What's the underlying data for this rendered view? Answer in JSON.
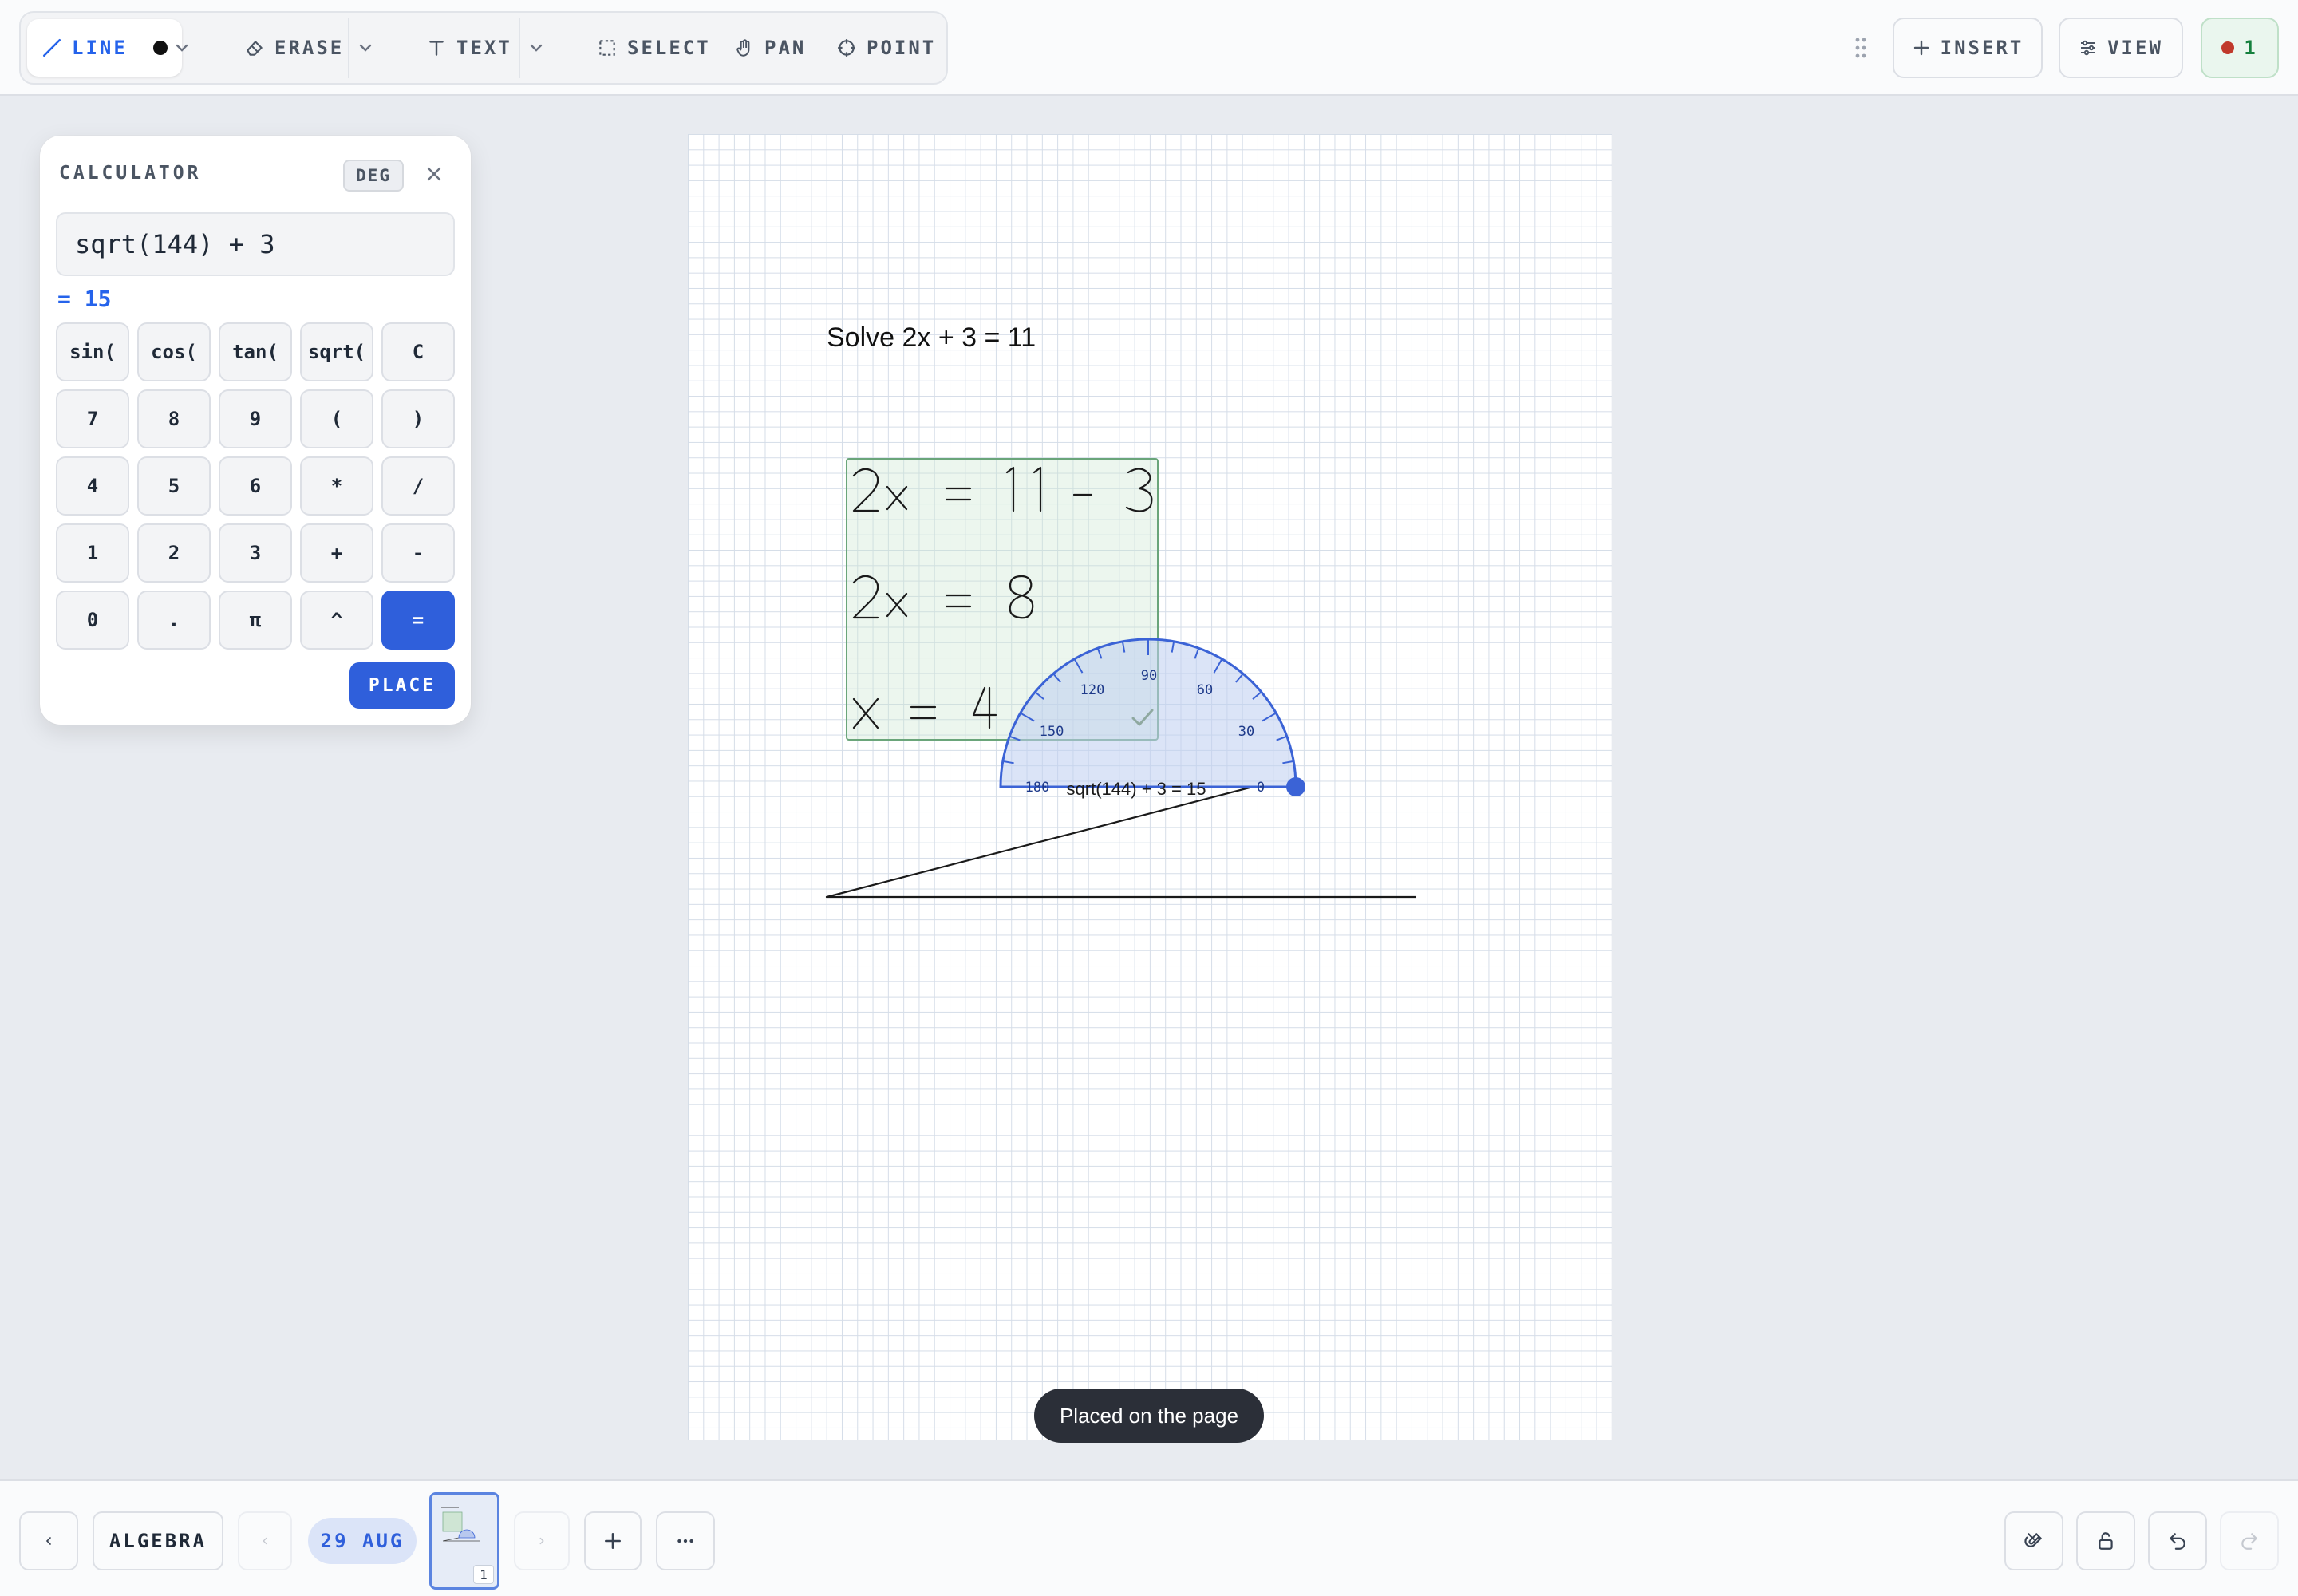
{
  "toolbar": {
    "line_label": "LINE",
    "erase_label": "ERASE",
    "text_label": "TEXT",
    "select_label": "SELECT",
    "pan_label": "PAN",
    "point_label": "POINT",
    "insert_label": "INSERT",
    "view_label": "VIEW",
    "record_count": "1",
    "colors": {
      "active": "#2563eb",
      "pen": "#111111",
      "record_dot": "#c0392b",
      "record_bg": "#eaf6ee"
    }
  },
  "calculator": {
    "title": "CALCULATOR",
    "mode": "DEG",
    "expression": "sqrt(144) + 3",
    "result": "= 15",
    "keys": [
      [
        "sin(",
        "cos(",
        "tan(",
        "sqrt(",
        "C"
      ],
      [
        "7",
        "8",
        "9",
        "(",
        ")"
      ],
      [
        "4",
        "5",
        "6",
        "*",
        "/"
      ],
      [
        "1",
        "2",
        "3",
        "+",
        "-"
      ],
      [
        "0",
        ".",
        "π",
        "^",
        "="
      ]
    ],
    "place_label": "PLACE"
  },
  "canvas": {
    "problem_text": "Solve  2x + 3 = 11",
    "handwriting": [
      "2x = 11 - 3",
      "2x = 8",
      "x = 4"
    ],
    "protractor": {
      "labels": [
        "180",
        "150",
        "120",
        "90",
        "60",
        "30",
        "0"
      ],
      "placed_text": "sqrt(144) + 3 = 15"
    }
  },
  "toast": {
    "message": "Placed on the page"
  },
  "bottombar": {
    "notebook_label": "ALGEBRA",
    "date_label": "29 AUG",
    "page_number": "1"
  }
}
